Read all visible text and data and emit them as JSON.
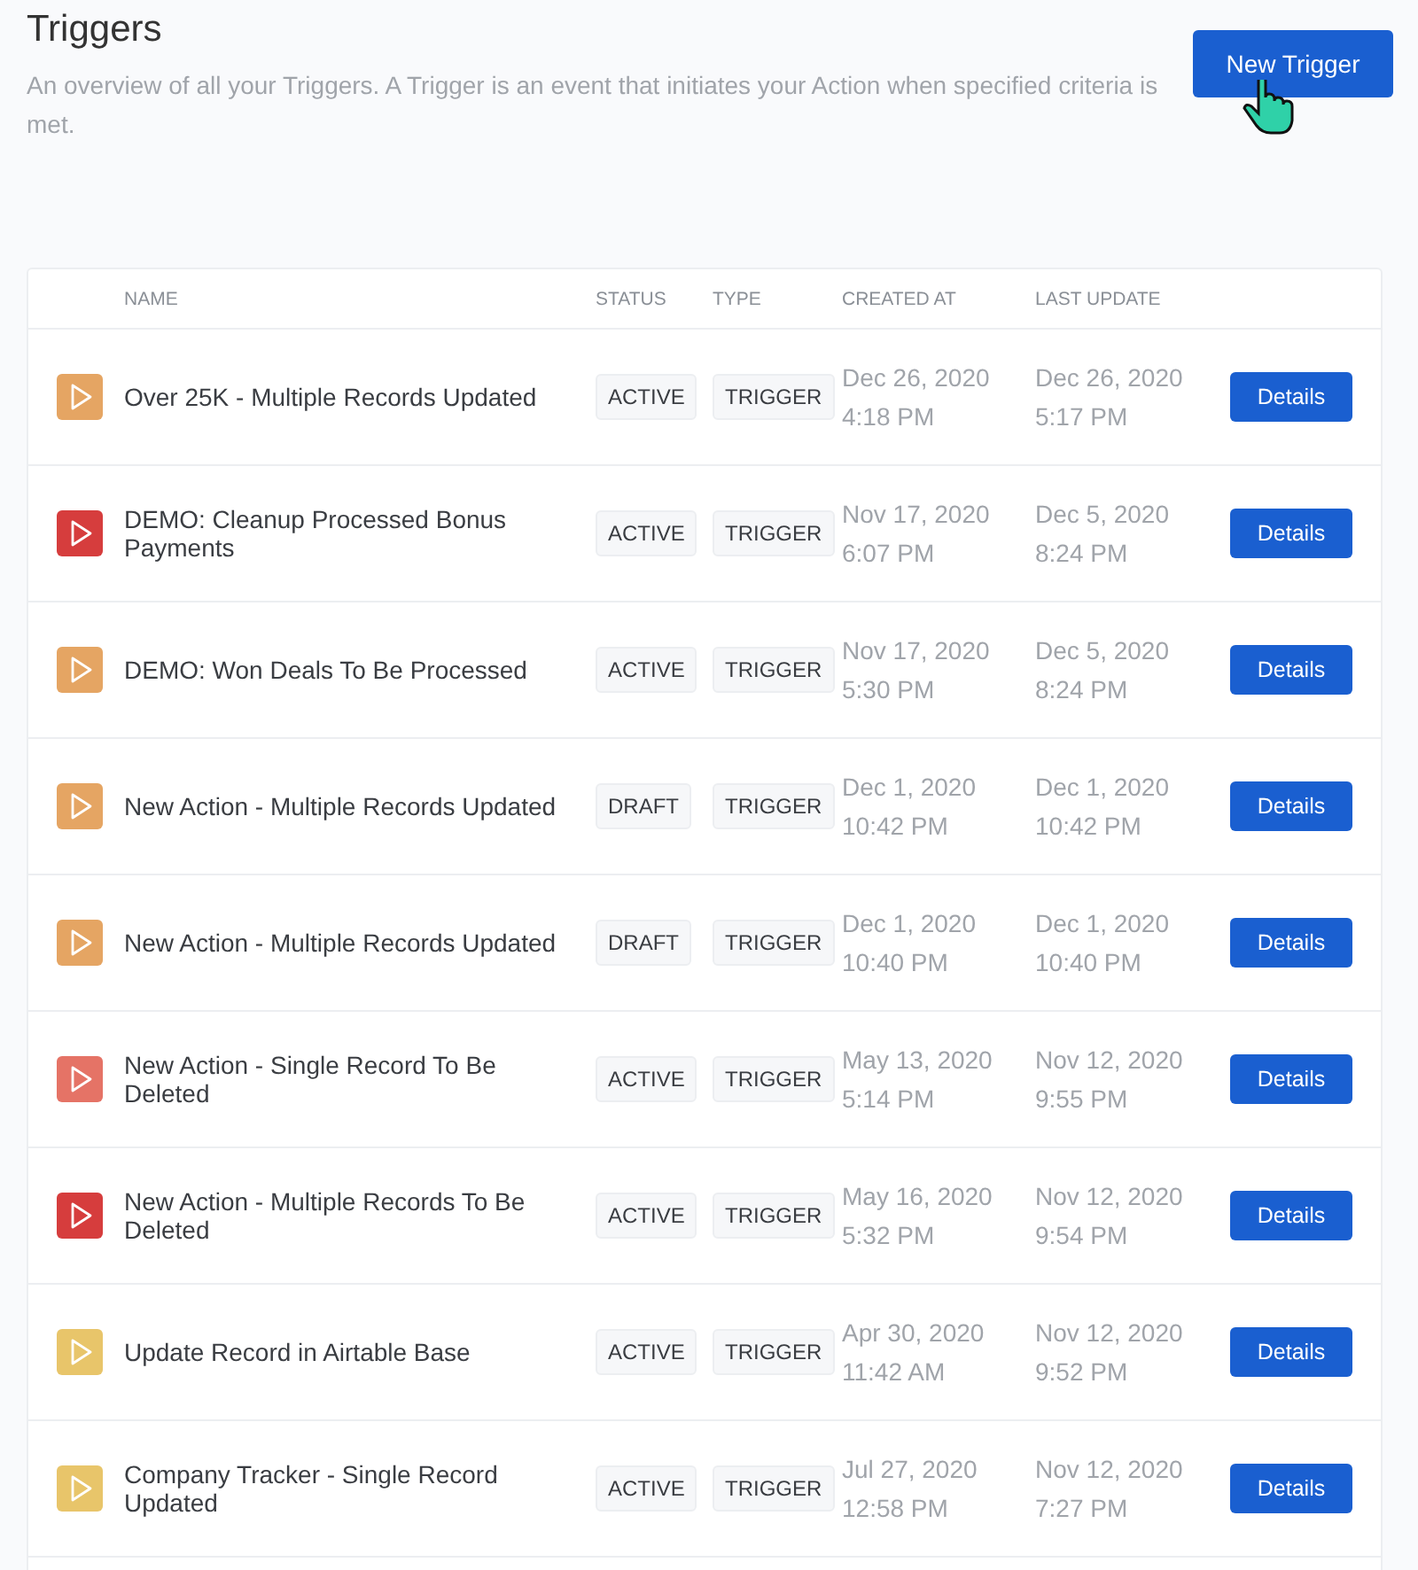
{
  "page": {
    "title": "Triggers",
    "description": "An overview of all your Triggers. A Trigger is an event that initiates your Action when specified criteria is met.",
    "new_button": "New Trigger"
  },
  "table": {
    "columns": [
      "NAME",
      "STATUS",
      "TYPE",
      "CREATED AT",
      "LAST UPDATE"
    ],
    "rows": [
      {
        "name": "Over 25K - Multiple Records Updated",
        "color": "#e5a563",
        "status": "ACTIVE",
        "type": "TRIGGER",
        "created_date": "Dec 26, 2020",
        "created_time": "4:18 PM",
        "updated_date": "Dec 26, 2020",
        "updated_time": "5:17 PM",
        "action": "Details"
      },
      {
        "name": "DEMO: Cleanup Processed Bonus Payments",
        "color": "#d63d3d",
        "status": "ACTIVE",
        "type": "TRIGGER",
        "created_date": "Nov 17, 2020",
        "created_time": "6:07 PM",
        "updated_date": "Dec 5, 2020",
        "updated_time": "8:24 PM",
        "action": "Details"
      },
      {
        "name": "DEMO: Won Deals To Be Processed",
        "color": "#e5a563",
        "status": "ACTIVE",
        "type": "TRIGGER",
        "created_date": "Nov 17, 2020",
        "created_time": "5:30 PM",
        "updated_date": "Dec 5, 2020",
        "updated_time": "8:24 PM",
        "action": "Details"
      },
      {
        "name": "New Action - Multiple Records Updated",
        "color": "#e5a563",
        "status": "DRAFT",
        "type": "TRIGGER",
        "created_date": "Dec 1, 2020",
        "created_time": "10:42 PM",
        "updated_date": "Dec 1, 2020",
        "updated_time": "10:42 PM",
        "action": "Details"
      },
      {
        "name": "New Action - Multiple Records Updated",
        "color": "#e5a563",
        "status": "DRAFT",
        "type": "TRIGGER",
        "created_date": "Dec 1, 2020",
        "created_time": "10:40 PM",
        "updated_date": "Dec 1, 2020",
        "updated_time": "10:40 PM",
        "action": "Details"
      },
      {
        "name": "New Action - Single Record To Be Deleted",
        "color": "#e57366",
        "status": "ACTIVE",
        "type": "TRIGGER",
        "created_date": "May 13, 2020",
        "created_time": "5:14 PM",
        "updated_date": "Nov 12, 2020",
        "updated_time": "9:55 PM",
        "action": "Details"
      },
      {
        "name": "New Action - Multiple Records To Be Deleted",
        "color": "#d63d3d",
        "status": "ACTIVE",
        "type": "TRIGGER",
        "created_date": "May 16, 2020",
        "created_time": "5:32 PM",
        "updated_date": "Nov 12, 2020",
        "updated_time": "9:54 PM",
        "action": "Details"
      },
      {
        "name": "Update Record in Airtable Base",
        "color": "#e8c56a",
        "status": "ACTIVE",
        "type": "TRIGGER",
        "created_date": "Apr 30, 2020",
        "created_time": "11:42 AM",
        "updated_date": "Nov 12, 2020",
        "updated_time": "9:52 PM",
        "action": "Details"
      },
      {
        "name": "Company Tracker - Single Record Updated",
        "color": "#e8c56a",
        "status": "ACTIVE",
        "type": "TRIGGER",
        "created_date": "Jul 27, 2020",
        "created_time": "12:58 PM",
        "updated_date": "Nov 12, 2020",
        "updated_time": "7:27 PM",
        "action": "Details"
      }
    ]
  }
}
